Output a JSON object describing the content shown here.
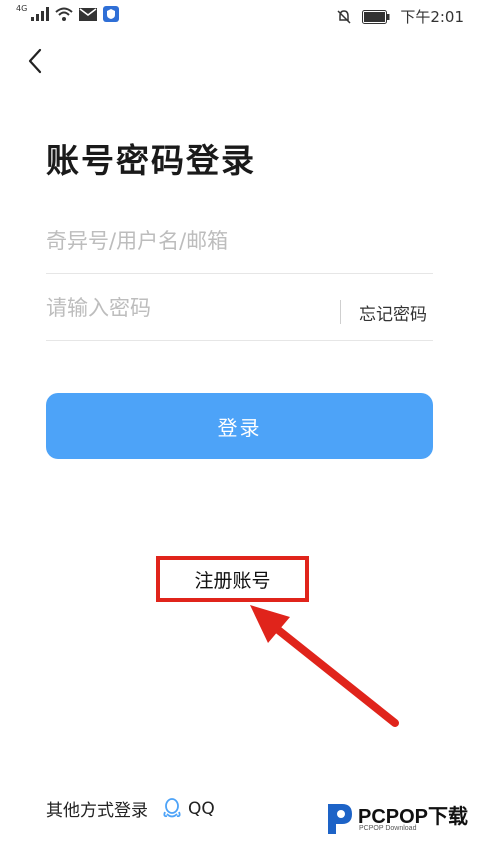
{
  "status_bar": {
    "network_type": "4G",
    "time": "下午2:01"
  },
  "page": {
    "title": "账号密码登录"
  },
  "form": {
    "account_placeholder": "奇异号/用户名/邮箱",
    "password_placeholder": "请输入密码",
    "forgot_password": "忘记密码",
    "login_button": "登录"
  },
  "register": {
    "label": "注册账号"
  },
  "other_login": {
    "label": "其他方式登录",
    "qq_label": "QQ"
  },
  "watermark": {
    "brand": "PCPOP下载",
    "sub": "PCPOP Download"
  },
  "colors": {
    "accent": "#4da3f8",
    "annotation_red": "#e0241b"
  }
}
